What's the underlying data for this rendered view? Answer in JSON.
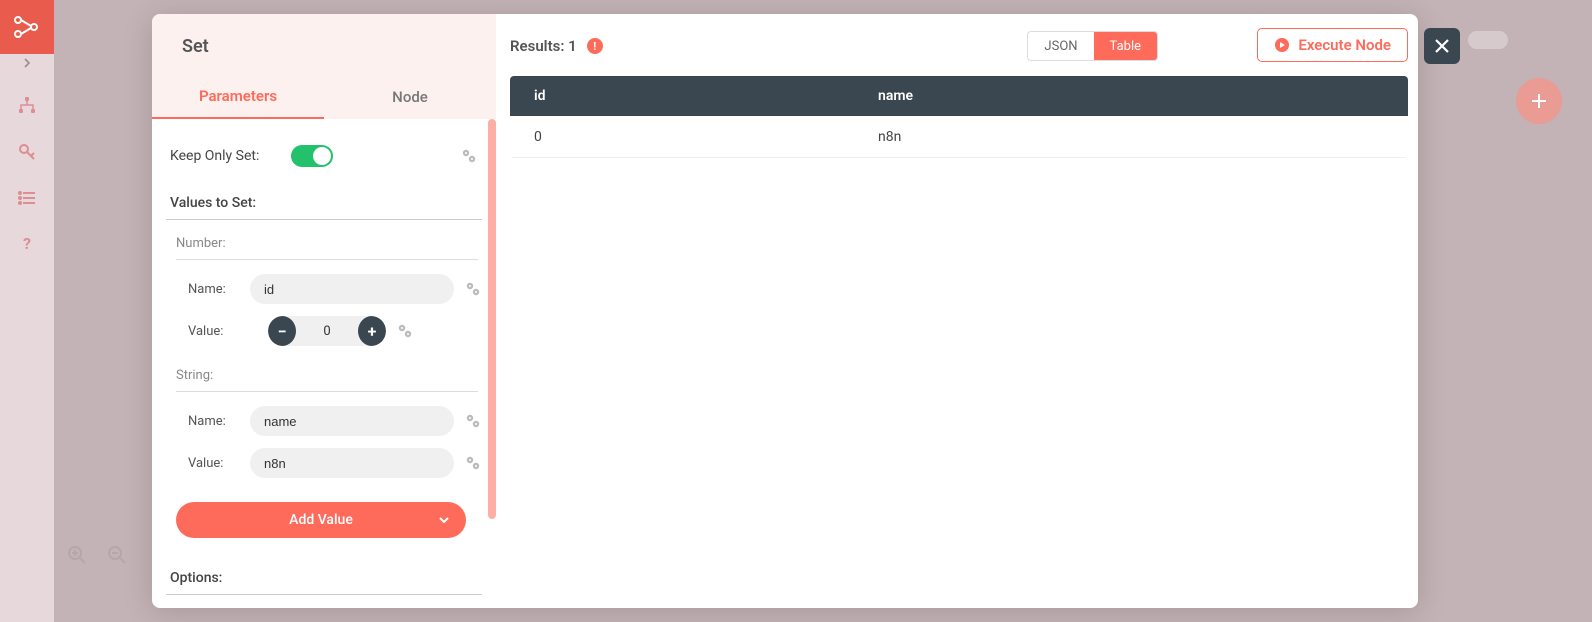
{
  "sidebar": {
    "icons": [
      "workflow-icon",
      "key-icon",
      "list-icon",
      "help-icon"
    ]
  },
  "modal": {
    "title": "Set",
    "tabs": {
      "parameters": "Parameters",
      "node": "Node"
    },
    "params": {
      "keepOnlySet": "Keep Only Set:",
      "valuesToSet": "Values to Set:",
      "numberLabel": "Number:",
      "stringLabel": "String:",
      "fieldName": "Name:",
      "fieldValue": "Value:",
      "number": {
        "name": "id",
        "value": "0"
      },
      "string": {
        "name": "name",
        "value": "n8n"
      },
      "addValue": "Add Value",
      "options": "Options:"
    },
    "results": {
      "label": "Results: ",
      "count": "1",
      "viewJson": "JSON",
      "viewTable": "Table",
      "execute": "Execute Node",
      "columns": {
        "id": "id",
        "name": "name"
      },
      "rows": [
        {
          "id": "0",
          "name": "n8n"
        }
      ]
    }
  }
}
